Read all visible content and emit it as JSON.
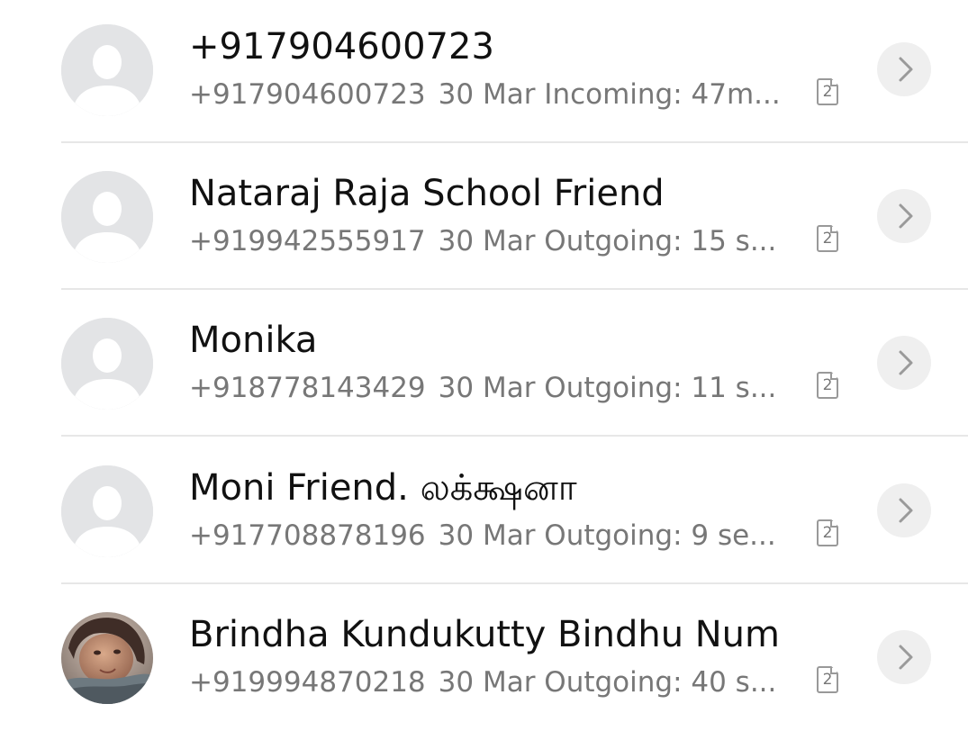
{
  "calls": [
    {
      "name": "+917904600723",
      "number": "+917904600723",
      "summary": "30 Mar Incoming: 47m...",
      "sim": "2",
      "avatar_icon": "default-person-icon"
    },
    {
      "name": "Nataraj Raja School Friend",
      "number": "+919942555917",
      "summary": "30 Mar Outgoing: 15 s...",
      "sim": "2",
      "avatar_icon": "default-person-icon"
    },
    {
      "name": "Monika",
      "number": "+918778143429",
      "summary": "30 Mar Outgoing: 11 s...",
      "sim": "2",
      "avatar_icon": "default-person-icon"
    },
    {
      "name": "Moni Friend. லக்க்ஷனா",
      "number": "+917708878196",
      "summary": "30 Mar Outgoing: 9 se...",
      "sim": "2",
      "avatar_icon": "default-person-icon"
    },
    {
      "name": "Brindha Kundukutty Bindhu Num",
      "number": "+919994870218",
      "summary": "30 Mar Outgoing: 40 s...",
      "sim": "2",
      "avatar_icon": "contact-photo"
    }
  ],
  "colors": {
    "name_text": "#111111",
    "detail_text": "#777777",
    "avatar_bg": "#e3e4e6",
    "avatar_glyph": "#ffffff",
    "button_bg": "#efefef",
    "chevron": "#9a9a9a",
    "divider": "#e7e7e7"
  }
}
